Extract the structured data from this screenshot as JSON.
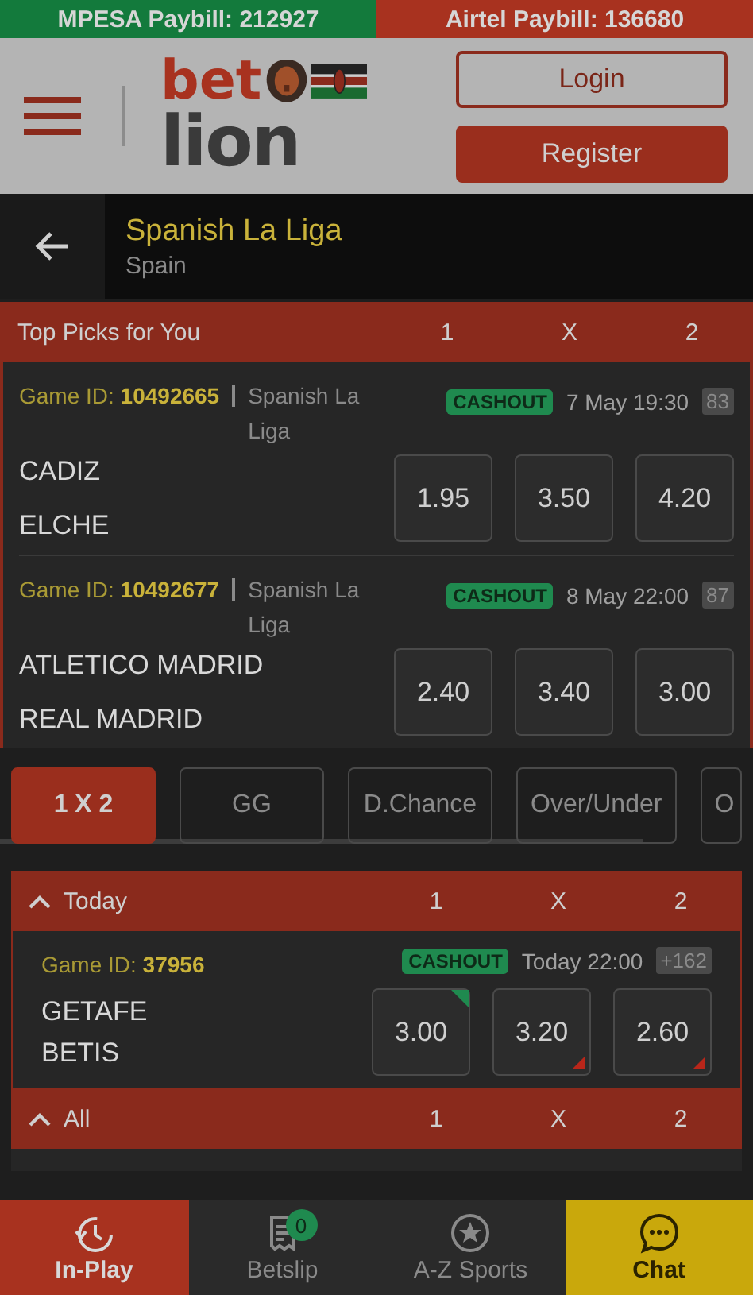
{
  "paybills": [
    {
      "text": "MPESA Paybill: 212927",
      "color": "#137a3c"
    },
    {
      "text": "Airtel Paybill: 136680",
      "color": "#a8321f"
    }
  ],
  "header": {
    "logo_top": "bet",
    "logo_bottom": "lion",
    "login": "Login",
    "register": "Register"
  },
  "league": {
    "title": "Spanish La Liga",
    "country": "Spain"
  },
  "top_picks": {
    "title": "Top Picks for You",
    "columns": [
      "1",
      "X",
      "2"
    ],
    "matches": [
      {
        "game_id": "Game ID: **10492665**",
        "league": "Spanish La Liga",
        "cashout": "CASHOUT",
        "time": "7 May 19:30",
        "markets": "83",
        "home": "CADIZ",
        "away": "ELCHE",
        "odds": [
          {
            "value": "1.95",
            "moved_up": false,
            "moved_down": false
          },
          {
            "value": "3.50",
            "moved_up": false,
            "moved_down": false
          },
          {
            "value": "4.20",
            "moved_up": false,
            "moved_down": false
          }
        ]
      },
      {
        "game_id": "Game ID: **10492677**",
        "league": "Spanish La Liga",
        "cashout": "CASHOUT",
        "time": "8 May 22:00",
        "markets": "87",
        "home": "ATLETICO MADRID",
        "away": "REAL MADRID",
        "odds": [
          {
            "value": "2.40",
            "moved_up": false,
            "moved_down": false
          },
          {
            "value": "3.40",
            "moved_up": false,
            "moved_down": false
          },
          {
            "value": "3.00",
            "moved_up": false,
            "moved_down": false
          }
        ]
      }
    ]
  },
  "market_tabs": [
    {
      "label": "1 X 2",
      "selected": true
    },
    {
      "label": "GG",
      "selected": false
    },
    {
      "label": "D.Chance",
      "selected": false
    },
    {
      "label": "Over/Under",
      "selected": false
    },
    {
      "label": "O",
      "selected": false
    }
  ],
  "sections": [
    {
      "title": "Today",
      "expanded": true,
      "columns": [
        "1",
        "X",
        "2"
      ],
      "matches": [
        {
          "game_id": "Game ID: **37956**",
          "cashout": "CASHOUT",
          "time": "Today 22:00",
          "markets": "+162",
          "home": "GETAFE",
          "away": "BETIS",
          "odds": [
            {
              "value": "3.00",
              "moved_up": true,
              "moved_down": false
            },
            {
              "value": "3.20",
              "moved_up": false,
              "moved_down": true
            },
            {
              "value": "2.60",
              "moved_up": false,
              "moved_down": true
            }
          ]
        }
      ]
    },
    {
      "title": "All",
      "expanded": true,
      "columns": [
        "1",
        "X",
        "2"
      ]
    }
  ],
  "bottom_nav": [
    {
      "label": "In-Play",
      "color": "#a8321f"
    },
    {
      "label": "Betslip",
      "color": "#2a2a2a",
      "badge": "0"
    },
    {
      "label": "A-Z Sports",
      "color": "#2a2a2a"
    },
    {
      "label": "Chat",
      "color": "#c9a80c"
    }
  ]
}
